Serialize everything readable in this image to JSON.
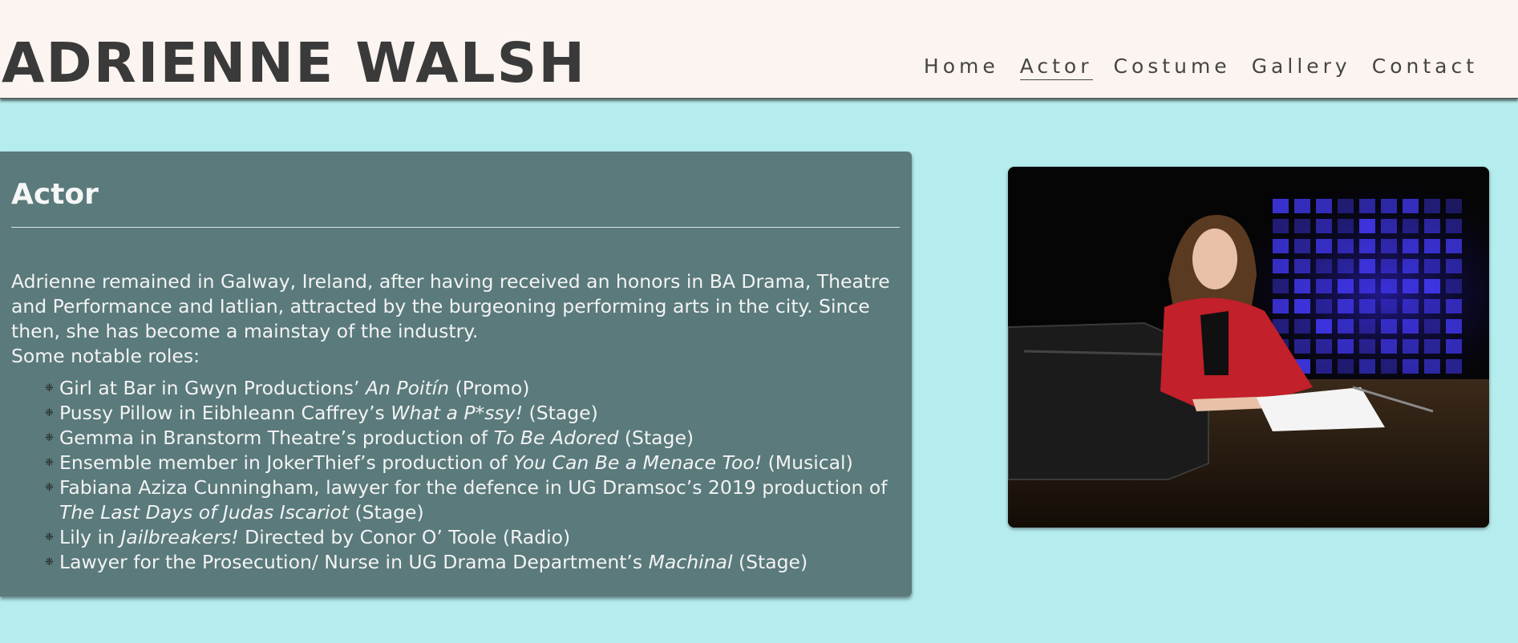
{
  "header": {
    "title": "ADRIENNE WALSH",
    "nav": [
      {
        "label": "Home"
      },
      {
        "label": "Actor",
        "active": true
      },
      {
        "label": "Costume"
      },
      {
        "label": "Gallery"
      },
      {
        "label": "Contact"
      }
    ]
  },
  "colors": {
    "page_background": "#b5ecee",
    "header_background": "#fcf4f0",
    "card_background": "#5a7a7b",
    "title_text": "#393a39"
  },
  "main": {
    "heading": "Actor",
    "intro": "Adrienne remained in Galway, Ireland, after having received an honors in BA Drama, Theatre and Performance and Iatlian, attracted by the burgeoning performing arts in the city. Since then, she has become a mainstay of the industry.",
    "roles_intro": "Some notable roles:",
    "roles": [
      {
        "before": "Girl at Bar in Gwyn Productions’ ",
        "title": "An Poitín",
        "after": " (Promo)"
      },
      {
        "before": "Pussy Pillow in Eibhleann Caffrey’s ",
        "title": "What a P*ssy!",
        "after": " (Stage)"
      },
      {
        "before": "Gemma in Branstorm Theatre’s production of ",
        "title": "To Be Adored",
        "after": " (Stage)"
      },
      {
        "before": "Ensemble member in JokerThief’s production of ",
        "title": "You Can Be a Menace Too!",
        "after": " (Musical)"
      },
      {
        "before": "Fabiana Aziza Cunningham, lawyer for the defence in UG Dramsoc’s 2019 production of ",
        "title": "The Last Days of Judas Iscariot",
        "after": " (Stage)"
      },
      {
        "before": "Lily in ",
        "title": "Jailbreakers!",
        "after": " Directed by Conor O’ Toole (Radio)"
      },
      {
        "before": "Lawyer for the Prosecution/ Nurse in UG Drama Department’s ",
        "title": "Machinal",
        "after": " (Stage)"
      }
    ]
  },
  "photo": {
    "icon": "actor-stage-photo"
  }
}
